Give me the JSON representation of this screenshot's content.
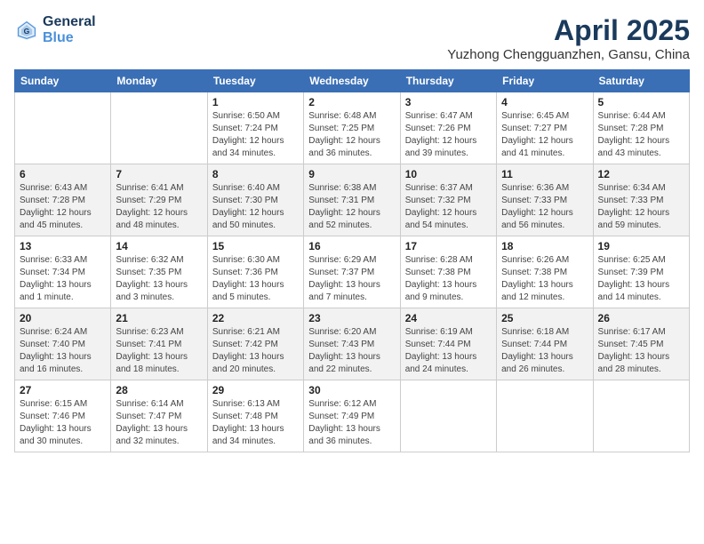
{
  "logo": {
    "line1": "General",
    "line2": "Blue"
  },
  "title": "April 2025",
  "subtitle": "Yuzhong Chengguanzhen, Gansu, China",
  "days_header": [
    "Sunday",
    "Monday",
    "Tuesday",
    "Wednesday",
    "Thursday",
    "Friday",
    "Saturday"
  ],
  "weeks": [
    [
      {
        "num": "",
        "info": ""
      },
      {
        "num": "",
        "info": ""
      },
      {
        "num": "1",
        "info": "Sunrise: 6:50 AM\nSunset: 7:24 PM\nDaylight: 12 hours and 34 minutes."
      },
      {
        "num": "2",
        "info": "Sunrise: 6:48 AM\nSunset: 7:25 PM\nDaylight: 12 hours and 36 minutes."
      },
      {
        "num": "3",
        "info": "Sunrise: 6:47 AM\nSunset: 7:26 PM\nDaylight: 12 hours and 39 minutes."
      },
      {
        "num": "4",
        "info": "Sunrise: 6:45 AM\nSunset: 7:27 PM\nDaylight: 12 hours and 41 minutes."
      },
      {
        "num": "5",
        "info": "Sunrise: 6:44 AM\nSunset: 7:28 PM\nDaylight: 12 hours and 43 minutes."
      }
    ],
    [
      {
        "num": "6",
        "info": "Sunrise: 6:43 AM\nSunset: 7:28 PM\nDaylight: 12 hours and 45 minutes."
      },
      {
        "num": "7",
        "info": "Sunrise: 6:41 AM\nSunset: 7:29 PM\nDaylight: 12 hours and 48 minutes."
      },
      {
        "num": "8",
        "info": "Sunrise: 6:40 AM\nSunset: 7:30 PM\nDaylight: 12 hours and 50 minutes."
      },
      {
        "num": "9",
        "info": "Sunrise: 6:38 AM\nSunset: 7:31 PM\nDaylight: 12 hours and 52 minutes."
      },
      {
        "num": "10",
        "info": "Sunrise: 6:37 AM\nSunset: 7:32 PM\nDaylight: 12 hours and 54 minutes."
      },
      {
        "num": "11",
        "info": "Sunrise: 6:36 AM\nSunset: 7:33 PM\nDaylight: 12 hours and 56 minutes."
      },
      {
        "num": "12",
        "info": "Sunrise: 6:34 AM\nSunset: 7:33 PM\nDaylight: 12 hours and 59 minutes."
      }
    ],
    [
      {
        "num": "13",
        "info": "Sunrise: 6:33 AM\nSunset: 7:34 PM\nDaylight: 13 hours and 1 minute."
      },
      {
        "num": "14",
        "info": "Sunrise: 6:32 AM\nSunset: 7:35 PM\nDaylight: 13 hours and 3 minutes."
      },
      {
        "num": "15",
        "info": "Sunrise: 6:30 AM\nSunset: 7:36 PM\nDaylight: 13 hours and 5 minutes."
      },
      {
        "num": "16",
        "info": "Sunrise: 6:29 AM\nSunset: 7:37 PM\nDaylight: 13 hours and 7 minutes."
      },
      {
        "num": "17",
        "info": "Sunrise: 6:28 AM\nSunset: 7:38 PM\nDaylight: 13 hours and 9 minutes."
      },
      {
        "num": "18",
        "info": "Sunrise: 6:26 AM\nSunset: 7:38 PM\nDaylight: 13 hours and 12 minutes."
      },
      {
        "num": "19",
        "info": "Sunrise: 6:25 AM\nSunset: 7:39 PM\nDaylight: 13 hours and 14 minutes."
      }
    ],
    [
      {
        "num": "20",
        "info": "Sunrise: 6:24 AM\nSunset: 7:40 PM\nDaylight: 13 hours and 16 minutes."
      },
      {
        "num": "21",
        "info": "Sunrise: 6:23 AM\nSunset: 7:41 PM\nDaylight: 13 hours and 18 minutes."
      },
      {
        "num": "22",
        "info": "Sunrise: 6:21 AM\nSunset: 7:42 PM\nDaylight: 13 hours and 20 minutes."
      },
      {
        "num": "23",
        "info": "Sunrise: 6:20 AM\nSunset: 7:43 PM\nDaylight: 13 hours and 22 minutes."
      },
      {
        "num": "24",
        "info": "Sunrise: 6:19 AM\nSunset: 7:44 PM\nDaylight: 13 hours and 24 minutes."
      },
      {
        "num": "25",
        "info": "Sunrise: 6:18 AM\nSunset: 7:44 PM\nDaylight: 13 hours and 26 minutes."
      },
      {
        "num": "26",
        "info": "Sunrise: 6:17 AM\nSunset: 7:45 PM\nDaylight: 13 hours and 28 minutes."
      }
    ],
    [
      {
        "num": "27",
        "info": "Sunrise: 6:15 AM\nSunset: 7:46 PM\nDaylight: 13 hours and 30 minutes."
      },
      {
        "num": "28",
        "info": "Sunrise: 6:14 AM\nSunset: 7:47 PM\nDaylight: 13 hours and 32 minutes."
      },
      {
        "num": "29",
        "info": "Sunrise: 6:13 AM\nSunset: 7:48 PM\nDaylight: 13 hours and 34 minutes."
      },
      {
        "num": "30",
        "info": "Sunrise: 6:12 AM\nSunset: 7:49 PM\nDaylight: 13 hours and 36 minutes."
      },
      {
        "num": "",
        "info": ""
      },
      {
        "num": "",
        "info": ""
      },
      {
        "num": "",
        "info": ""
      }
    ]
  ]
}
